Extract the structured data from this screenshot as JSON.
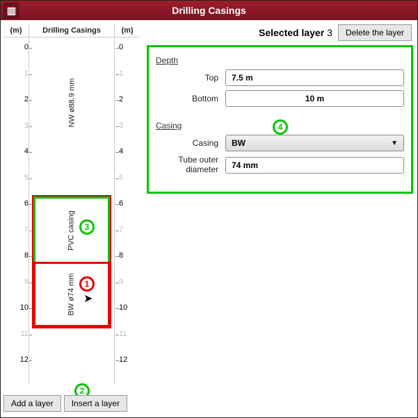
{
  "title": "Drilling Casings",
  "left": {
    "header_unit": "(m)",
    "header_main": "Drilling Casings",
    "ticks": [
      0,
      1,
      2,
      3,
      4,
      5,
      6,
      7,
      8,
      9,
      10,
      11,
      12
    ],
    "layers": [
      {
        "id": 1,
        "label": "NW ø88.9 mm"
      },
      {
        "id": 2,
        "label": "PVC casing"
      },
      {
        "id": 3,
        "label": "BW ø74 mm"
      }
    ],
    "markers": {
      "m1": "1",
      "m2": "2",
      "m3": "3"
    },
    "add_label": "Add a layer",
    "insert_label": "Insert a layer"
  },
  "right": {
    "selected_label": "Selected layer",
    "selected_index": "3",
    "delete_label": "Delete the layer",
    "depth_title": "Depth",
    "top_label": "Top",
    "top_value": "7.5 m",
    "bottom_label": "Bottom",
    "bottom_value": "10 m",
    "casing_title": "Casing",
    "casing_label": "Casing",
    "casing_value": "BW",
    "diam_label": "Tube outer diameter",
    "diam_value": "74 mm",
    "marker4": "4"
  }
}
